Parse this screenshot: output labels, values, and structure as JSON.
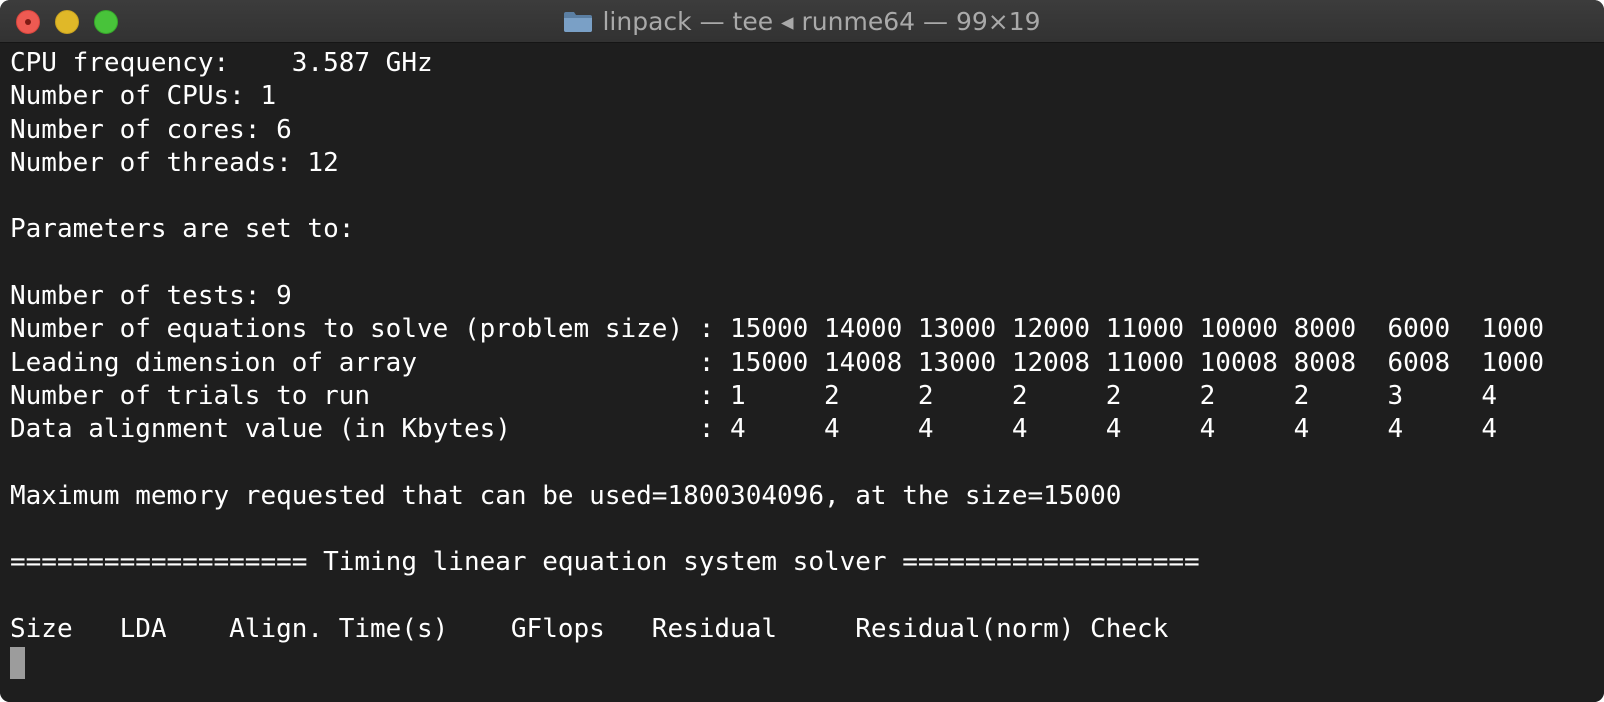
{
  "window": {
    "title": "linpack — tee ◂ runme64 — 99×19",
    "folder_icon": "folder-icon",
    "controls": [
      "close",
      "minimize",
      "zoom"
    ],
    "colors": {
      "background": "#1e1e1e",
      "text": "#ffffff",
      "titlebar": "#363636",
      "close": "#ee5a52",
      "minimize": "#e0b828",
      "zoom": "#48c33a"
    }
  },
  "terminal": {
    "lines": [
      "CPU frequency:    3.587 GHz",
      "Number of CPUs: 1",
      "Number of cores: 6",
      "Number of threads: 12",
      "",
      "Parameters are set to:",
      "",
      "Number of tests: 9",
      "Number of equations to solve (problem size) : 15000 14000 13000 12000 11000 10000 8000  6000  1000",
      "Leading dimension of array                  : 15000 14008 13000 12008 11000 10008 8008  6008  1000",
      "Number of trials to run                     : 1     2     2     2     2     2     2     3     4",
      "Data alignment value (in Kbytes)            : 4     4     4     4     4     4     4     4     4",
      "",
      "Maximum memory requested that can be used=1800304096, at the size=15000",
      "",
      "=================== Timing linear equation system solver ===================",
      "",
      "Size   LDA    Align. Time(s)    GFlops   Residual     Residual(norm) Check"
    ]
  }
}
